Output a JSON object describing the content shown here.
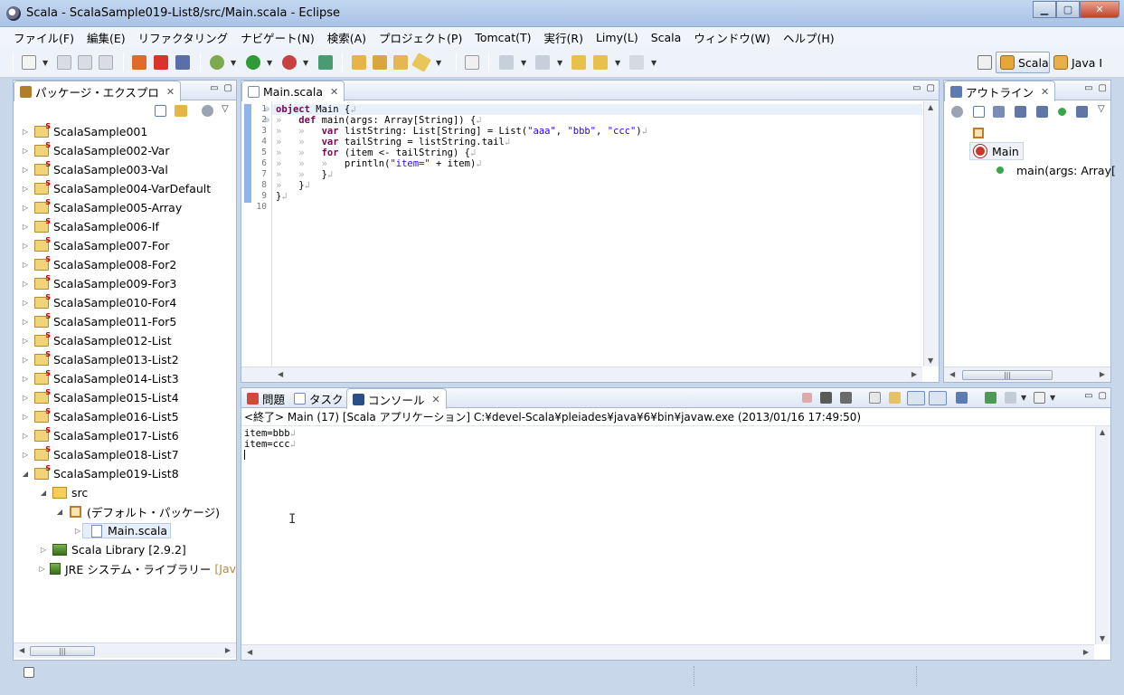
{
  "window": {
    "title": "Scala - ScalaSample019-List8/src/Main.scala - Eclipse",
    "controls": {
      "minimize": "▁",
      "maximize": "▢",
      "close": "✕"
    }
  },
  "menu": [
    "ファイル(F)",
    "編集(E)",
    "リファクタリング",
    "ナビゲート(N)",
    "検索(A)",
    "プロジェクト(P)",
    "Tomcat(T)",
    "実行(R)",
    "Limy(L)",
    "Scala",
    "ウィンドウ(W)",
    "ヘルプ(H)"
  ],
  "perspectives": {
    "scala": "Scala",
    "java": "Java I"
  },
  "package_explorer": {
    "tab_label": "パッケージ・エクスプロ",
    "projects": [
      "ScalaSample001",
      "ScalaSample002-Var",
      "ScalaSample003-Val",
      "ScalaSample004-VarDefault",
      "ScalaSample005-Array",
      "ScalaSample006-If",
      "ScalaSample007-For",
      "ScalaSample008-For2",
      "ScalaSample009-For3",
      "ScalaSample010-For4",
      "ScalaSample011-For5",
      "ScalaSample012-List",
      "ScalaSample013-List2",
      "ScalaSample014-List3",
      "ScalaSample015-List4",
      "ScalaSample016-List5",
      "ScalaSample017-List6",
      "ScalaSample018-List7",
      "ScalaSample019-List8"
    ],
    "src_folder": "src",
    "default_package": "(デフォルト・パッケージ)",
    "main_file": "Main.scala",
    "scala_library": "Scala Library [2.9.2]",
    "jre_library": "JRE システム・ライブラリー",
    "jre_suffix": "[Jav"
  },
  "editor": {
    "tab_label": "Main.scala",
    "line_numbers": [
      "1",
      "2",
      "3",
      "4",
      "5",
      "6",
      "7",
      "8",
      "9",
      "10"
    ]
  },
  "outline": {
    "tab_label": "アウトライン",
    "object_name": "Main",
    "method_name": "main(args: Array["
  },
  "bottom": {
    "tabs": {
      "problems": "問題",
      "tasks": "タスク",
      "console": "コンソール"
    },
    "console_header": "<終了> Main (17) [Scala アプリケーション] C:¥devel-Scala¥pleiades¥java¥6¥bin¥javaw.exe (2013/01/16 17:49:50)",
    "output": [
      "item=bbb",
      "item=ccc"
    ]
  },
  "colors": {
    "keyword": "#7f0055",
    "string": "#2a00ff",
    "accent": "#8fb4e8"
  }
}
